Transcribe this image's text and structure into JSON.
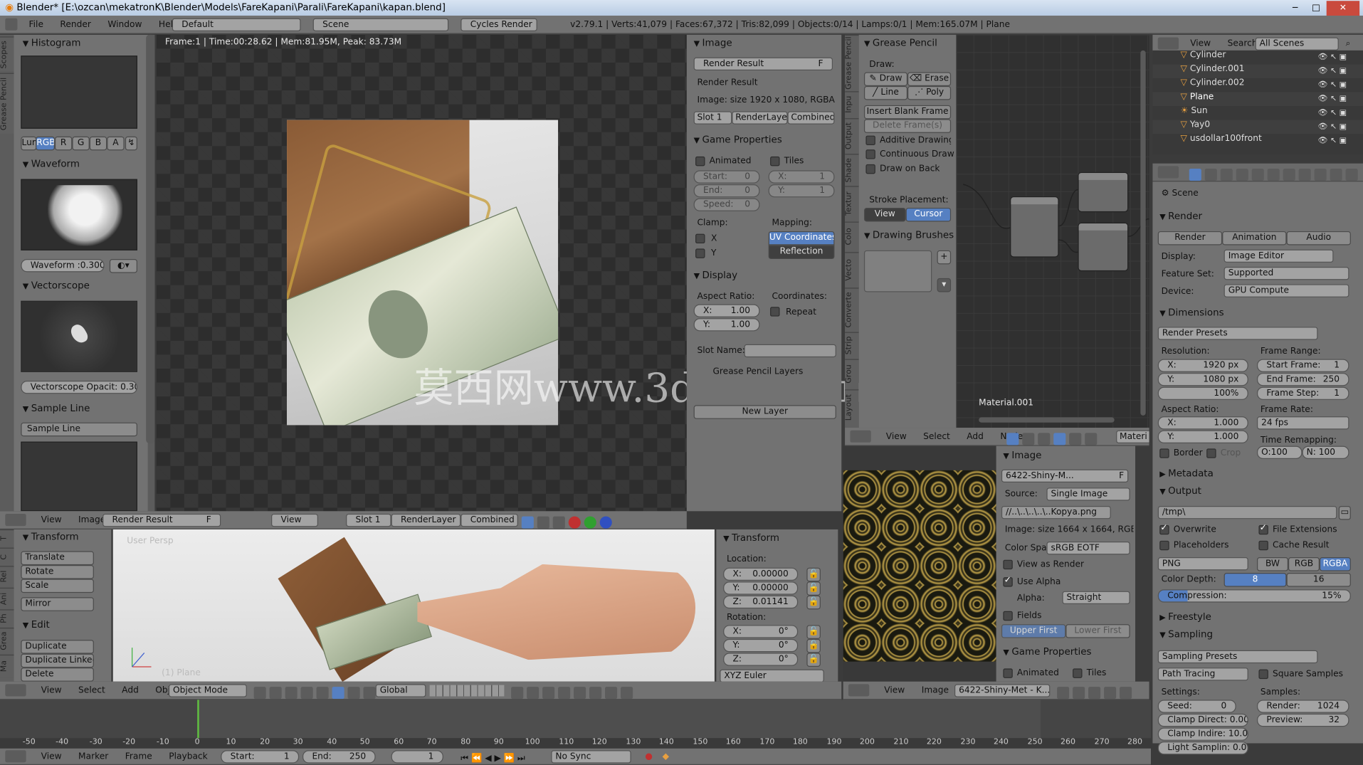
{
  "title_bar": {
    "text": "Blender* [E:\\ozcan\\mekatronK\\Blender\\Models\\FareKapani\\Parali\\FareKapani\\kapan.blend]"
  },
  "info_bar": {
    "menus": [
      "File",
      "Render",
      "Window",
      "Help"
    ],
    "layout": "Default",
    "scene": "Scene",
    "engine": "Cycles Render",
    "stats": "v2.79.1 | Verts:41,079 | Faces:67,372 | Tris:82,099 | Objects:0/14 | Lamps:0/1 | Mem:165.07M | Plane"
  },
  "scopes": {
    "tabs": [
      "Scopes",
      "Grease Pencil"
    ],
    "histogram": "Histogram",
    "channels": [
      "Lum",
      "RGB",
      "R",
      "G",
      "B",
      "A"
    ],
    "waveform": "Waveform",
    "waveform_field": "Waveform :0.300",
    "vectorscope": "Vectorscope",
    "vectorscope_field": "Vectorscope Opacit: 0.300",
    "sample_line": "Sample Line",
    "sample_line_btn": "Sample Line"
  },
  "render_view": {
    "status": "Frame:1 | Time:00:28.62 | Mem:81.95M, Peak: 83.73M",
    "watermark": "莫西网www.3dmox.com",
    "header": {
      "menus": [
        "View",
        "Image"
      ],
      "image_name": "Render Result",
      "f": "F",
      "view": "View",
      "slot": "Slot 1",
      "layer": "RenderLayer",
      "pass": "Combined"
    }
  },
  "image_props": {
    "image_sec": "Image",
    "image_name": "Render Result",
    "f": "F",
    "render_result": "Render Result",
    "image_size": "Image: size 1920 x 1080, RGBA float...",
    "slot": "Slot 1",
    "layer": "RenderLayer",
    "pass": "Combined",
    "game_sec": "Game Properties",
    "animated": "Animated",
    "tiles": "Tiles",
    "start": "Start:",
    "start_v": "0",
    "end": "End:",
    "end_v": "0",
    "speed": "Speed:",
    "speed_v": "0",
    "x": "X:",
    "x_v": "1",
    "y": "Y:",
    "y_v": "1",
    "clamp": "Clamp:",
    "mapping": "Mapping:",
    "cx": "X",
    "cy": "Y",
    "uv": "UV Coordinates",
    "reflection": "Reflection",
    "display_sec": "Display",
    "aspect": "Aspect Ratio:",
    "coords": "Coordinates:",
    "ax": "X:",
    "ax_v": "1.00",
    "ay": "Y:",
    "ay_v": "1.00",
    "repeat": "Repeat",
    "slot_name": "Slot Name:",
    "gp_layers": "Grease Pencil Layers",
    "new_layer": "New Layer"
  },
  "grease_pencil": {
    "sec": "Grease Pencil",
    "draw": "Draw:",
    "draw_btn": "Draw",
    "erase": "Erase",
    "line": "Line",
    "poly": "Poly",
    "insert": "Insert Blank Frame",
    "delete": "Delete Frame(s)",
    "additive": "Additive Drawing",
    "continuous": "Continuous Draw...",
    "draw_back": "Draw on Back",
    "stroke": "Stroke Placement:",
    "view": "View",
    "cursor": "Cursor",
    "brushes": "Drawing Brushes",
    "tabs": [
      "Grease Pencil",
      "Inpu",
      "Output",
      "Shade",
      "Textur",
      "Colo",
      "Vecto",
      "Converte",
      "Strip",
      "Grou",
      "Layout"
    ]
  },
  "node_editor": {
    "material": "Material.001",
    "header": [
      "View",
      "Select",
      "Add",
      "Node"
    ],
    "mat_field": "Materi"
  },
  "outliner": {
    "header": [
      "View",
      "Search"
    ],
    "scenes": "All Scenes",
    "items": [
      "Cylinder",
      "Cylinder.001",
      "Cylinder.002",
      "Plane",
      "Sun",
      "Yay0",
      "usdollar100front"
    ]
  },
  "properties": {
    "scene": "Scene",
    "render_sec": "Render",
    "render_btn": "Render",
    "animation_btn": "Animation",
    "audio_btn": "Audio",
    "display": "Display:",
    "display_v": "Image Editor",
    "feature": "Feature Set:",
    "feature_v": "Supported",
    "device": "Device:",
    "device_v": "GPU Compute",
    "dimensions": "Dimensions",
    "presets": "Render Presets",
    "resolution": "Resolution:",
    "rx": "X:",
    "rx_v": "1920 px",
    "ry": "Y:",
    "ry_v": "1080 px",
    "pct": "100%",
    "frame_range": "Frame Range:",
    "start_frame": "Start Frame:",
    "start_frame_v": "1",
    "end_frame": "End Frame:",
    "end_frame_v": "250",
    "frame_step": "Frame Step:",
    "frame_step_v": "1",
    "aspect": "Aspect Ratio:",
    "asx": "X:",
    "asx_v": "1.000",
    "asy": "Y:",
    "asy_v": "1.000",
    "frame_rate": "Frame Rate:",
    "fps": "24 fps",
    "remap": "Time Remapping:",
    "o": "O:100",
    "n": "N: 100",
    "border": "Border",
    "crop": "Crop",
    "metadata": "Metadata",
    "output": "Output",
    "path": "/tmp\\",
    "overwrite": "Overwrite",
    "file_ext": "File Extensions",
    "placeholders": "Placeholders",
    "cache": "Cache Result",
    "format": "PNG",
    "bw": "BW",
    "rgb": "RGB",
    "rgba": "RGBA",
    "depth": "Color Depth:",
    "d8": "8",
    "d16": "16",
    "compression": "Compression:",
    "compression_v": "15%",
    "freestyle": "Freestyle",
    "sampling": "Sampling",
    "sampling_presets": "Sampling Presets",
    "path_tracing": "Path Tracing",
    "square": "Square Samples",
    "settings": "Settings:",
    "samples": "Samples:",
    "seed": "Seed:",
    "seed_v": "0",
    "clamp_direct": "Clamp Direct: 0.00",
    "clamp_indirect": "Clamp Indire: 10.00",
    "light_sampling": "Light Samplin: 0.01",
    "render_s": "Render:",
    "render_s_v": "1024",
    "preview_s": "Preview:",
    "preview_s_v": "32"
  },
  "viewport": {
    "transform_sec": "Transform",
    "translate": "Translate",
    "rotate": "Rotate",
    "scale": "Scale",
    "mirror": "Mirror",
    "edit_sec": "Edit",
    "duplicate": "Duplicate",
    "dup_linked": "Duplicate Linked",
    "delete": "Delete",
    "label": "User Persp",
    "obj": "(1) Plane",
    "tabs": [
      "T",
      "C",
      "Rel",
      "Ani",
      "Ph",
      "Grea",
      "Ma"
    ],
    "header": [
      "View",
      "Select",
      "Add",
      "Object"
    ],
    "mode": "Object Mode",
    "orient": "Global"
  },
  "transform_panel": {
    "sec": "Transform",
    "location": "Location:",
    "lx": "X:",
    "lx_v": "0.00000",
    "ly": "Y:",
    "ly_v": "0.00000",
    "lz": "Z:",
    "lz_v": "0.01141",
    "rotation": "Rotation:",
    "rx": "X:",
    "rx_v": "0°",
    "ry": "Y:",
    "ry_v": "0°",
    "rz": "Z:",
    "rz_v": "0°",
    "mode": "XYZ Euler"
  },
  "texture_props": {
    "image_sec": "Image",
    "image_name": "6422-Shiny-M...",
    "f": "F",
    "source": "Source:",
    "source_v": "Single Image",
    "file": "//..\\..\\..\\..\\..Kopya.png",
    "size": "Image: size 1664 x 1664, RGB byte",
    "color_space": "Color Spac",
    "color_space_v": "sRGB EOTF",
    "view_render": "View as Render",
    "use_alpha": "Use Alpha",
    "alpha": "Alpha:",
    "alpha_v": "Straight",
    "fields": "Fields",
    "upper": "Upper First",
    "lower": "Lower First",
    "game_sec": "Game Properties",
    "animated": "Animated",
    "tiles": "Tiles",
    "header": [
      "View",
      "Image"
    ],
    "image_field": "6422-Shiny-Met - K..."
  },
  "timeline": {
    "ticks": [
      "-50",
      "-40",
      "-30",
      "-20",
      "-10",
      "0",
      "10",
      "20",
      "30",
      "40",
      "50",
      "60",
      "70",
      "80",
      "90",
      "100",
      "110",
      "120",
      "130",
      "140",
      "150",
      "160",
      "170",
      "180",
      "190",
      "200",
      "210",
      "220",
      "230",
      "240",
      "250",
      "260",
      "270",
      "280"
    ],
    "header": [
      "View",
      "Marker",
      "Frame",
      "Playback"
    ],
    "start": "Start:",
    "start_v": "1",
    "end": "End:",
    "end_v": "250",
    "current": "1",
    "sync": "No Sync"
  }
}
